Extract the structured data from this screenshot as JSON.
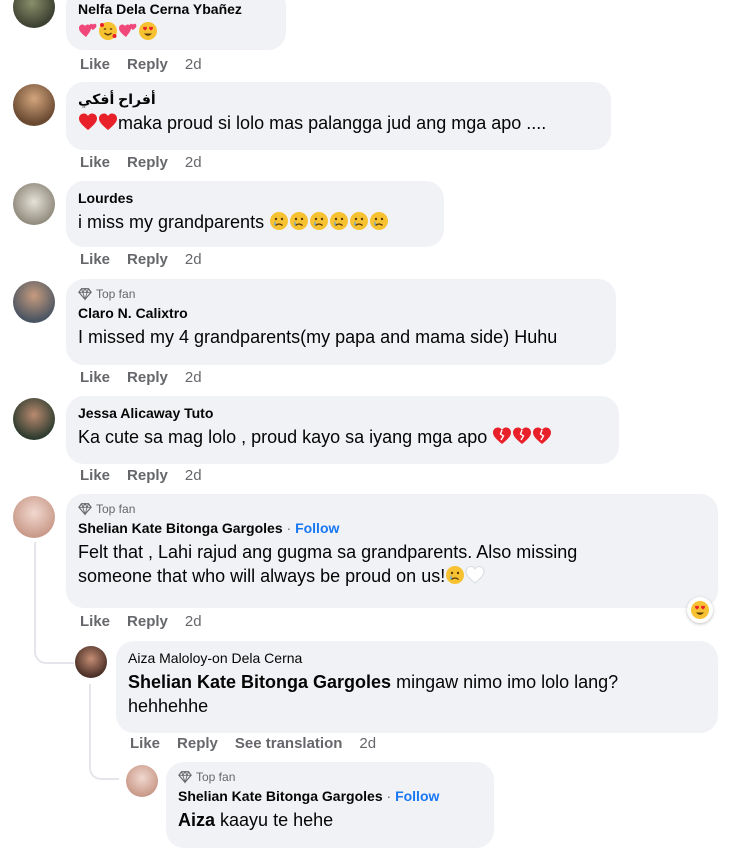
{
  "icons": {
    "top_fan": "diamond-icon",
    "heart": "red-heart",
    "crying": "crying-face",
    "hug": "care-reaction"
  },
  "colors": {
    "bubble_bg": "#f0f2f5",
    "action_text": "#65676b",
    "link_blue": "#1877f2"
  },
  "labels": {
    "like": "Like",
    "reply": "Reply",
    "see_translation": "See translation",
    "follow": "Follow",
    "top_fan": "Top fan"
  },
  "comments": [
    {
      "name": "Nelfa Dela Cerna Ybañez",
      "text": "",
      "time": "2d"
    },
    {
      "name": "أفراح أفكي",
      "text": "maka proud si lolo mas palangga jud ang mga apo ....",
      "time": "2d"
    },
    {
      "name": "Lourdes",
      "text": "i miss my grandparents",
      "time": "2d"
    },
    {
      "name": "Claro N. Calixtro",
      "text": "I missed my 4 grandparents(my papa and mama side) Huhu",
      "time": "2d"
    },
    {
      "name": "Jessa Alicaway Tuto",
      "text": "Ka cute sa mag lolo , proud kayo sa iyang mga apo",
      "time": "2d"
    },
    {
      "name": "Shelian Kate Bitonga Gargoles",
      "text_line1": "Felt that , Lahi rajud ang gugma sa grandparents. Also missing",
      "text_line2": "someone that who will always be proud on us!",
      "time": "2d"
    },
    {
      "name": "Aiza Maloloy-on Dela Cerna",
      "mention": "Shelian Kate Bitonga Gargoles",
      "text_line1": "mingaw nimo imo lolo lang?",
      "text_line2": "hehhehhe",
      "time": "2d"
    },
    {
      "name": "Shelian Kate Bitonga Gargoles",
      "mention": "Aiza",
      "text": "kaayu te hehe"
    }
  ]
}
